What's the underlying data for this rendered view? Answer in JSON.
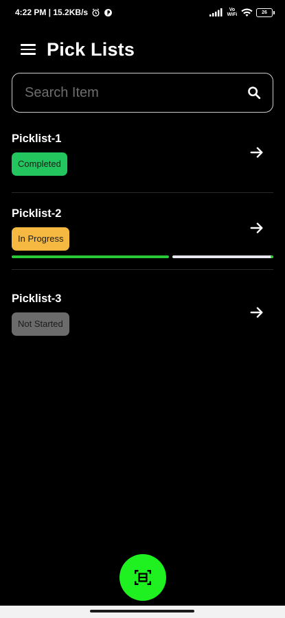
{
  "status_bar": {
    "time_speed": "4:22 PM | 15.2KB/s",
    "network_label": "Vo WiFi",
    "battery": "26"
  },
  "header": {
    "title": "Pick Lists",
    "menu_icon": "hamburger-menu-icon"
  },
  "search": {
    "placeholder": "Search Item",
    "value": "",
    "icon": "search-icon"
  },
  "picklists": [
    {
      "name": "Picklist-1",
      "status": "Completed",
      "status_color": "#22c55e"
    },
    {
      "name": "Picklist-2",
      "status": "In Progress",
      "status_color": "#f5b942",
      "progress": 0.6
    },
    {
      "name": "Picklist-3",
      "status": "Not Started",
      "status_color": "#6b6b6b"
    }
  ],
  "fab": {
    "icon": "scan-icon",
    "color": "#1ff01f"
  },
  "colors": {
    "background": "#000000",
    "progress_done": "#28c936",
    "progress_remaining": "#e8e6ee"
  }
}
